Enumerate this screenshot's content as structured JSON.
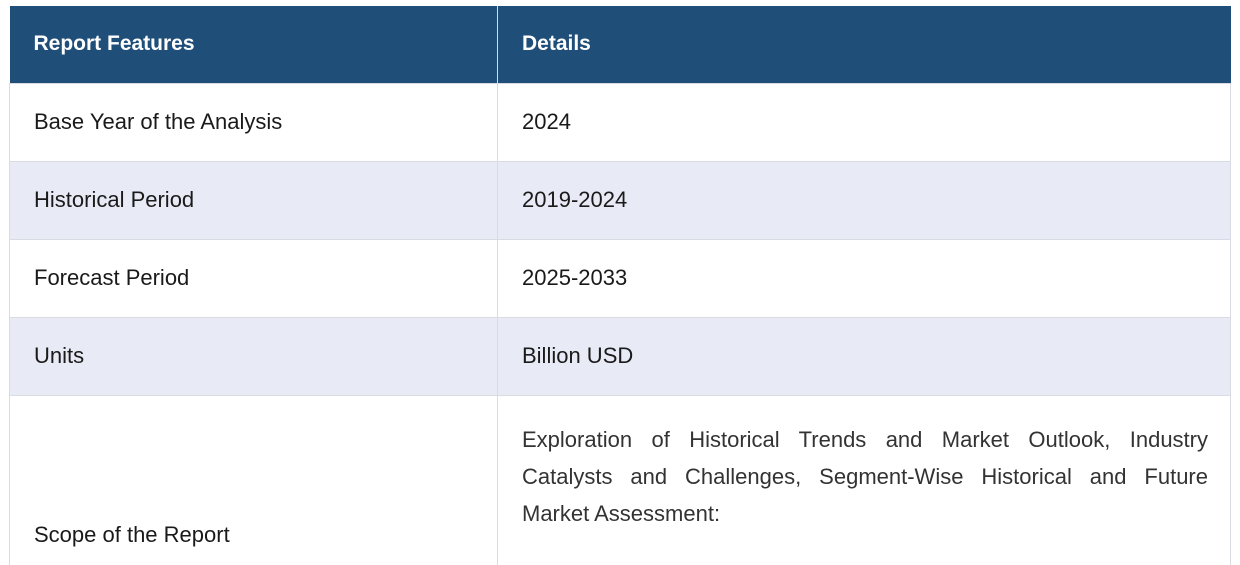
{
  "table": {
    "headers": [
      "Report Features",
      "Details"
    ],
    "rows": [
      {
        "feature": "Base Year of the Analysis",
        "detail": "2024"
      },
      {
        "feature": "Historical Period",
        "detail": "2019-2024"
      },
      {
        "feature": "Forecast Period",
        "detail": "2025-2033"
      },
      {
        "feature": "Units",
        "detail": "Billion USD"
      },
      {
        "feature": "Scope of the Report",
        "detail": "Exploration of Historical Trends and Market Outlook, Industry Catalysts and Challenges, Segment-Wise Historical and Future Market Assessment:"
      }
    ]
  },
  "colors": {
    "header_bg": "#1f4e79",
    "alt_row_bg": "#e8eaf6",
    "border": "#d9dbe2"
  }
}
